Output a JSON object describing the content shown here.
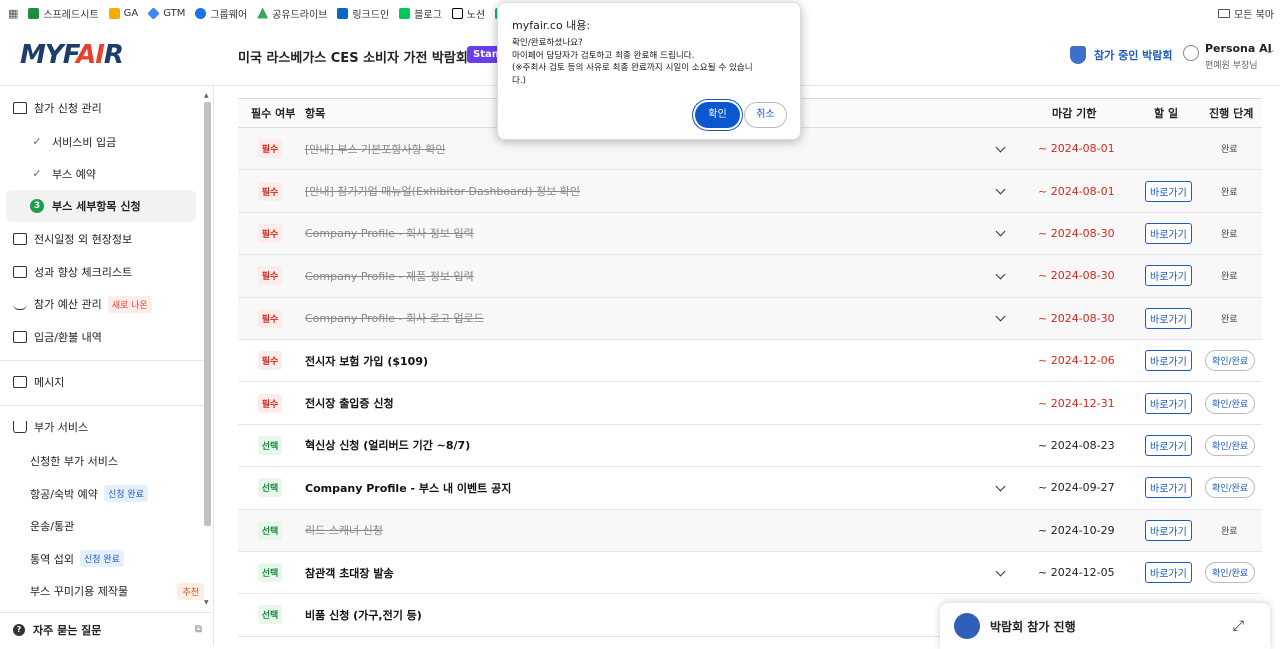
{
  "bookmarks": {
    "items": [
      {
        "label": "",
        "icon": "apps-grid-icon",
        "color": "#555555"
      },
      {
        "label": "스프레드시트",
        "icon": "sheets-icon",
        "color": "#1e8e3e"
      },
      {
        "label": "GA",
        "icon": "analytics-icon",
        "color": "#f9ab00"
      },
      {
        "label": "GTM",
        "icon": "tag-manager-icon",
        "color": "#4285f4"
      },
      {
        "label": "그룹웨어",
        "icon": "groupware-icon",
        "color": "#1a73e8"
      },
      {
        "label": "공유드라이브",
        "icon": "drive-icon",
        "color": "#34a853"
      },
      {
        "label": "링크드인",
        "icon": "linkedin-icon",
        "color": "#0a66c2"
      },
      {
        "label": "블로그",
        "icon": "blog-icon",
        "color": "#03c75a"
      },
      {
        "label": "노션",
        "icon": "notion-icon",
        "color": "#000000"
      },
      {
        "label": "",
        "icon": "naver-icon",
        "color": "#03c75a"
      }
    ],
    "all_bookmarks": "모든 북마"
  },
  "header": {
    "logo_main": "MYF",
    "logo_accent": "AI",
    "logo_tail": "R",
    "expo_title": "미국 라스베가스 CES 소비자 가전 박람회 2025",
    "badge": "Stand",
    "joining": "참가 중인 박람회",
    "user_name": "Persona AI",
    "user_sub": "편예원 부장님"
  },
  "sidebar": {
    "section1": "참가 신청 관리",
    "sub1": "서비스비 입금",
    "sub2": "부스 예약",
    "sub3_num": "3",
    "sub3": "부스 세부항목 신청",
    "menu2": "전시일정 외 현장정보",
    "menu3": "성과 향상 체크리스트",
    "menu4": "참가 예산 관리",
    "menu4_tag": "새로 나온",
    "menu5": "입금/환불 내역",
    "menu6": "메시지",
    "menu7": "부가 서비스",
    "svc1": "신청한 부가 서비스",
    "svc2": "항공/숙박 예약",
    "svc2_tag": "신청 완료",
    "svc3": "운송/통관",
    "svc4": "통역 섭외",
    "svc4_tag": "신청 완료",
    "svc5": "부스 꾸미기용 제작물",
    "svc5_tag": "추천",
    "faq": "자주 묻는 질문"
  },
  "table": {
    "headers": {
      "req": "필수 여부",
      "item": "항목",
      "deadline": "마감 기한",
      "todo": "할 일",
      "stage": "진행 단계"
    },
    "rows": [
      {
        "req": "필수",
        "item": "[안내] 부스 기본포함사항 확인",
        "done": true,
        "chev": true,
        "date": "~ 2024-08-01",
        "date_red": true,
        "go": "",
        "stage": "완료",
        "stage_btn": false
      },
      {
        "req": "필수",
        "item": "[안내] 참가기업 매뉴얼(Exhibitor Dashboard) 정보 확인",
        "done": true,
        "chev": true,
        "date": "~ 2024-08-01",
        "date_red": true,
        "go": "바로가기",
        "stage": "완료",
        "stage_btn": false
      },
      {
        "req": "필수",
        "item": "Company Profile - 회사 정보 입력",
        "done": true,
        "chev": true,
        "date": "~ 2024-08-30",
        "date_red": true,
        "go": "바로가기",
        "stage": "완료",
        "stage_btn": false
      },
      {
        "req": "필수",
        "item": "Company Profile - 제품 정보 입력",
        "done": true,
        "chev": true,
        "date": "~ 2024-08-30",
        "date_red": true,
        "go": "바로가기",
        "stage": "완료",
        "stage_btn": false
      },
      {
        "req": "필수",
        "item": "Company Profile - 회사 로고 업로드",
        "done": true,
        "chev": true,
        "date": "~ 2024-08-30",
        "date_red": true,
        "go": "바로가기",
        "stage": "완료",
        "stage_btn": false
      },
      {
        "req": "필수",
        "item": "전시자 보험 가입 ($109)",
        "done": false,
        "chev": false,
        "date": "~ 2024-12-06",
        "date_red": true,
        "go": "바로가기",
        "stage": "확인/완료",
        "stage_btn": true
      },
      {
        "req": "필수",
        "item": "전시장 출입증 신청",
        "done": false,
        "chev": false,
        "date": "~ 2024-12-31",
        "date_red": true,
        "go": "바로가기",
        "stage": "확인/완료",
        "stage_btn": true
      },
      {
        "req": "선택",
        "item": "혁신상 신청 (얼리버드 기간 ~8/7)",
        "done": false,
        "chev": false,
        "date": "~ 2024-08-23",
        "date_red": false,
        "go": "바로가기",
        "stage": "확인/완료",
        "stage_btn": true
      },
      {
        "req": "선택",
        "item": "Company Profile - 부스 내 이벤트 공지",
        "done": false,
        "chev": true,
        "date": "~ 2024-09-27",
        "date_red": false,
        "go": "바로가기",
        "stage": "확인/완료",
        "stage_btn": true
      },
      {
        "req": "선택",
        "item": "리드 스캐너 신청",
        "done": true,
        "chev": false,
        "date": "~ 2024-10-29",
        "date_red": false,
        "go": "바로가기",
        "stage": "완료",
        "stage_btn": false
      },
      {
        "req": "선택",
        "item": "참관객 초대장 발송",
        "done": false,
        "chev": true,
        "date": "~ 2024-12-05",
        "date_red": false,
        "go": "바로가기",
        "stage": "확인/완료",
        "stage_btn": true
      },
      {
        "req": "선택",
        "item": "비품 신청 (가구,전기 등)",
        "done": false,
        "chev": false,
        "date": "",
        "date_red": false,
        "go": "",
        "stage": "",
        "stage_btn": false
      }
    ]
  },
  "dialog": {
    "title": "myfair.co 내용:",
    "message": "확인/완료하셨나요?\n마이페어 담당자가 검토하고 최종 완료해 드립니다.\n(※주최사 검토 등의 사유로 최종 완료까지 시일이 소요될 수 있습니\n다.)",
    "ok": "확인",
    "cancel": "취소"
  },
  "floating": {
    "label": "박람회 참가 진행"
  },
  "colors": {
    "brand_navy": "#1d3d6b",
    "brand_red": "#e8412c",
    "link_blue": "#1d5bbf",
    "required_red": "#d0281e",
    "optional_green": "#1a8a3e",
    "dialog_blue": "#0b57d0"
  }
}
